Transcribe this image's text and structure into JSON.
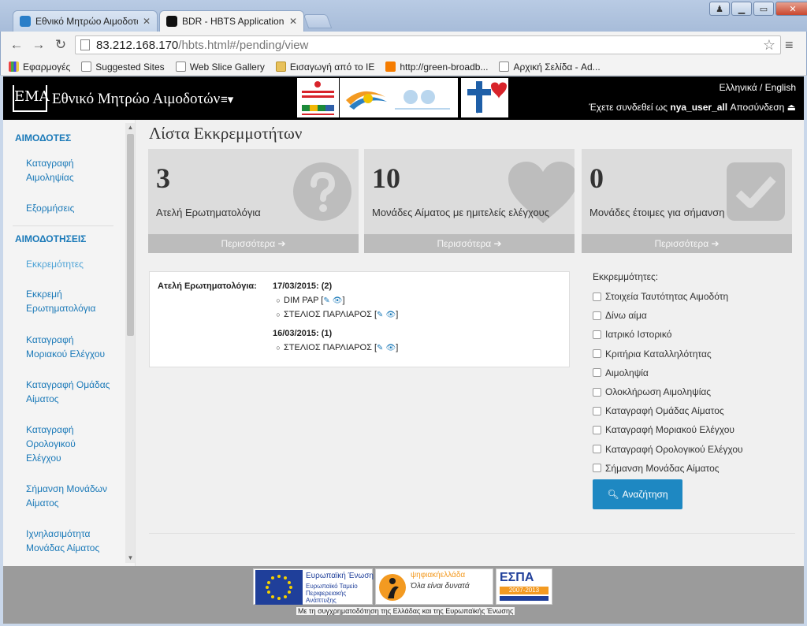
{
  "browser": {
    "tabs": [
      {
        "label": "Εθνικό Μητρώο Αιμοδοτών"
      },
      {
        "label": "BDR - HBTS Application"
      }
    ],
    "url_host": "83.212.168.170",
    "url_path": "/hbts.html#/pending/view",
    "bookmarks": [
      {
        "label": "Εφαρμογές"
      },
      {
        "label": "Suggested Sites"
      },
      {
        "label": "Web Slice Gallery"
      },
      {
        "label": "Εισαγωγή από το IE"
      },
      {
        "label": "http://green-broadb..."
      },
      {
        "label": "Αρχική Σελίδα - Ad..."
      }
    ]
  },
  "header": {
    "logo_text": "ΕΜΑ",
    "title": "Εθνικό Μητρώο Αιμοδοτών",
    "lang": "Ελληνικά / English",
    "login_prefix": "Έχετε συνδεθεί ως",
    "username": "nya_user_all",
    "logout": "Αποσύνδεση"
  },
  "sidebar": {
    "section1": "ΑΙΜΟΔΟΤΕΣ",
    "item_katagrafi_aimolipsias": "Καταγραφή Αιμοληψίας",
    "item_exoryxeis": "Εξορμήσεις",
    "section2": "ΑΙΜΟΔΟΤΗΣΕΙΣ",
    "item_ekkremotites": "Εκκρεμότητες",
    "item_ekkremi": "Εκκρεμή Ερωτηματολόγια",
    "item_moriakos": "Καταγραφή Μοριακού Ελέγχου",
    "item_omada": "Καταγραφή Ομάδας Αίματος",
    "item_orologikos": "Καταγραφή Ορολογικού Ελέγχου",
    "item_simansi": "Σήμανση Μονάδων Αίματος",
    "item_ixnilasimotita": "Ιχνηλασιμότητα Μονάδας Αίματος"
  },
  "main": {
    "title": "Λίστα Εκκρεμμοτήτων",
    "stats": [
      {
        "number": "3",
        "label": "Ατελή Ερωτηματολόγια",
        "more": "Περισσότερα",
        "icon": "question-icon"
      },
      {
        "number": "10",
        "label": "Μονάδες Αίματος με ημιτελείς ελέγχους",
        "more": "Περισσότερα",
        "icon": "heart-icon"
      },
      {
        "number": "0",
        "label": "Μονάδες έτοιμες για σήμανση",
        "more": "Περισσότερα",
        "icon": "check-icon"
      }
    ],
    "pending": {
      "label": "Ατελή Ερωτηματολόγια:",
      "groups": [
        {
          "date": "17/03/2015: (2)",
          "entries": [
            "DIM PAP",
            "ΣΤΕΛΙΟΣ ΠΑΡΛΙΑΡΟΣ"
          ]
        },
        {
          "date": "16/03/2015: (1)",
          "entries": [
            "ΣΤΕΛΙΟΣ ΠΑΡΛΙΑΡΟΣ"
          ]
        }
      ]
    },
    "filters": {
      "title": "Εκκρεμμότητες:",
      "options": [
        "Στοιχεία Ταυτότητας Αιμοδότη",
        "Δίνω αίμα",
        "Ιατρικό Ιστορικό",
        "Κριτήρια Καταλληλότητας",
        "Αιμοληψία",
        "Ολοκλήρωση Αιμοληψίας",
        "Καταγραφή Ομάδας Αίματος",
        "Καταγραφή Μοριακού Ελέγχου",
        "Καταγραφή Ορολογικού Ελέγχου",
        "Σήμανση Μονάδας Αίματος"
      ],
      "search_label": "Αναζήτηση"
    }
  },
  "footer": {
    "eu_title": "Ευρωπαϊκή Ένωση",
    "eu_fund": "Ευρωπαϊκό Ταμείο Περιφερειακής Ανάπτυξης",
    "digital_brand": "ψηφιακήελλάδα",
    "digital_slogan": "Όλα είναι δυνατά",
    "espa": "ΕΣΠΑ",
    "espa_years": "2007-2013",
    "note": "Με τη συγχρηματοδότηση της Ελλάδας και της Ευρωπαϊκής Ένωσης"
  },
  "colors": {
    "accent": "#1e88c2",
    "link": "#1a79b8",
    "header_bg": "#000000"
  }
}
